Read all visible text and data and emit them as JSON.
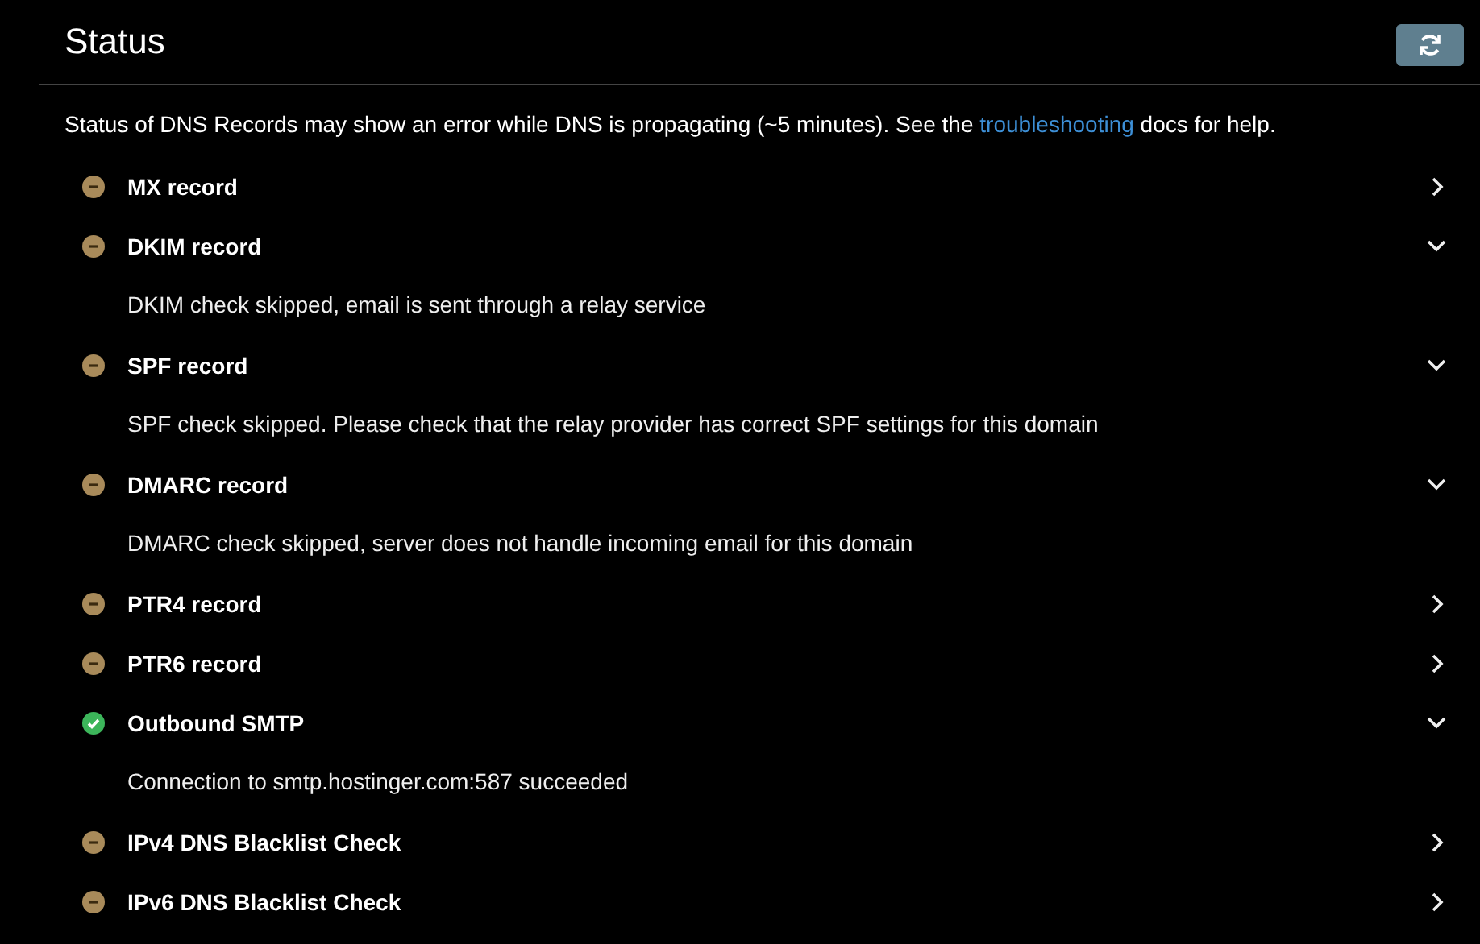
{
  "header": {
    "title": "Status"
  },
  "notice": {
    "text": "Status of DNS Records may show an error while DNS is propagating (~5 minutes). See the",
    "link": "troubleshooting",
    "after": "docs for help."
  },
  "checks": [
    {
      "name": "MX record",
      "kind": "skipped",
      "expanded": false
    },
    {
      "name": "DKIM record",
      "kind": "skipped",
      "expanded": true,
      "detail": "DKIM check skipped, email is sent through a relay service"
    },
    {
      "name": "SPF record",
      "kind": "skipped",
      "expanded": true,
      "detail": "SPF check skipped. Please check that the relay provider has correct SPF settings for this domain"
    },
    {
      "name": "DMARC record",
      "kind": "skipped",
      "expanded": true,
      "detail": "DMARC check skipped, server does not handle incoming email for this domain"
    },
    {
      "name": "PTR4 record",
      "kind": "skipped",
      "expanded": false
    },
    {
      "name": "PTR6 record",
      "kind": "skipped",
      "expanded": false
    },
    {
      "name": "Outbound SMTP",
      "kind": "ok",
      "expanded": true,
      "detail": "Connection to smtp.hostinger.com:587 succeeded"
    },
    {
      "name": "IPv4 DNS Blacklist Check",
      "kind": "skipped",
      "expanded": false
    },
    {
      "name": "IPv6 DNS Blacklist Check",
      "kind": "skipped",
      "expanded": false
    }
  ]
}
